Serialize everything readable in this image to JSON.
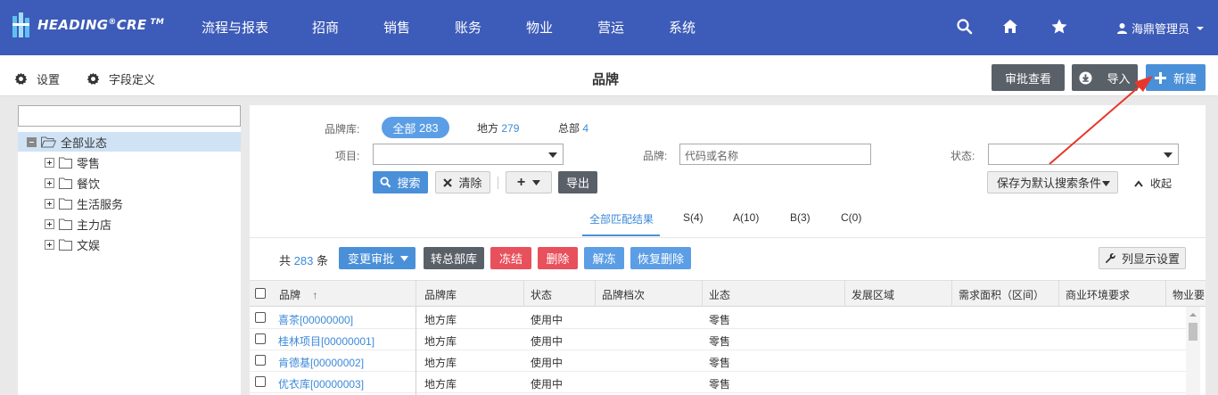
{
  "brand": {
    "name": "HEADING",
    "sup1": "®",
    "suffix": "CRE",
    "sup2": "TM"
  },
  "nav": {
    "items": [
      "流程与报表",
      "招商",
      "销售",
      "账务",
      "物业",
      "营运",
      "系统"
    ],
    "user_name": "海鼎管理员"
  },
  "toolbar": {
    "settings_label": "设置",
    "fields_label": "字段定义",
    "title": "品牌",
    "approval_view_label": "审批查看",
    "import_label": "导入",
    "new_label": "新建"
  },
  "tree": {
    "search_value": "",
    "root_label": "全部业态",
    "children": [
      "零售",
      "餐饮",
      "生活服务",
      "主力店",
      "文娱"
    ]
  },
  "filters": {
    "library_label": "品牌库:",
    "all_label": "全部",
    "all_count": "283",
    "local_label": "地方",
    "local_count": "279",
    "hq_label": "总部",
    "hq_count": "4",
    "project_label": "项目:",
    "project_value": "",
    "brand_label": "品牌:",
    "brand_placeholder": "代码或名称",
    "status_label": "状态:",
    "status_value": "",
    "search_button": "搜索",
    "clear_button": "清除",
    "add_button": "+",
    "export_button": "导出",
    "save_default_button": "保存为默认搜索条件",
    "collapse_label": "收起"
  },
  "result_tabs": [
    "全部匹配结果",
    "S(4)",
    "A(10)",
    "B(3)",
    "C(0)"
  ],
  "actions": {
    "total_prefix": "共",
    "total_count": "283",
    "total_suffix": "条",
    "change_approval": "变更审批",
    "to_hq": "转总部库",
    "freeze": "冻结",
    "delete": "删除",
    "unfreeze": "解冻",
    "restore_delete": "恢复删除",
    "column_settings": "列显示设置"
  },
  "table": {
    "columns": [
      "品牌",
      "品牌库",
      "状态",
      "品牌档次",
      "业态",
      "发展区域",
      "需求面积（区间）",
      "商业环境要求",
      "物业要"
    ],
    "sort_indicator": "↑",
    "rows": [
      {
        "brand": "喜茶[00000000]",
        "library": "地方库",
        "status": "使用中",
        "grade": "",
        "format": "零售"
      },
      {
        "brand": "桂林项目[00000001]",
        "library": "地方库",
        "status": "使用中",
        "grade": "",
        "format": "零售"
      },
      {
        "brand": "肯德基[00000002]",
        "library": "地方库",
        "status": "使用中",
        "grade": "",
        "format": "零售"
      },
      {
        "brand": "优衣库[00000003]",
        "library": "地方库",
        "status": "使用中",
        "grade": "",
        "format": "零售"
      }
    ]
  },
  "colors": {
    "nav_bg": "#3d5bb8",
    "primary": "#4a90d9",
    "danger": "#e8505b",
    "dark_button": "#5a6068",
    "annotation_arrow": "#e8352c"
  }
}
